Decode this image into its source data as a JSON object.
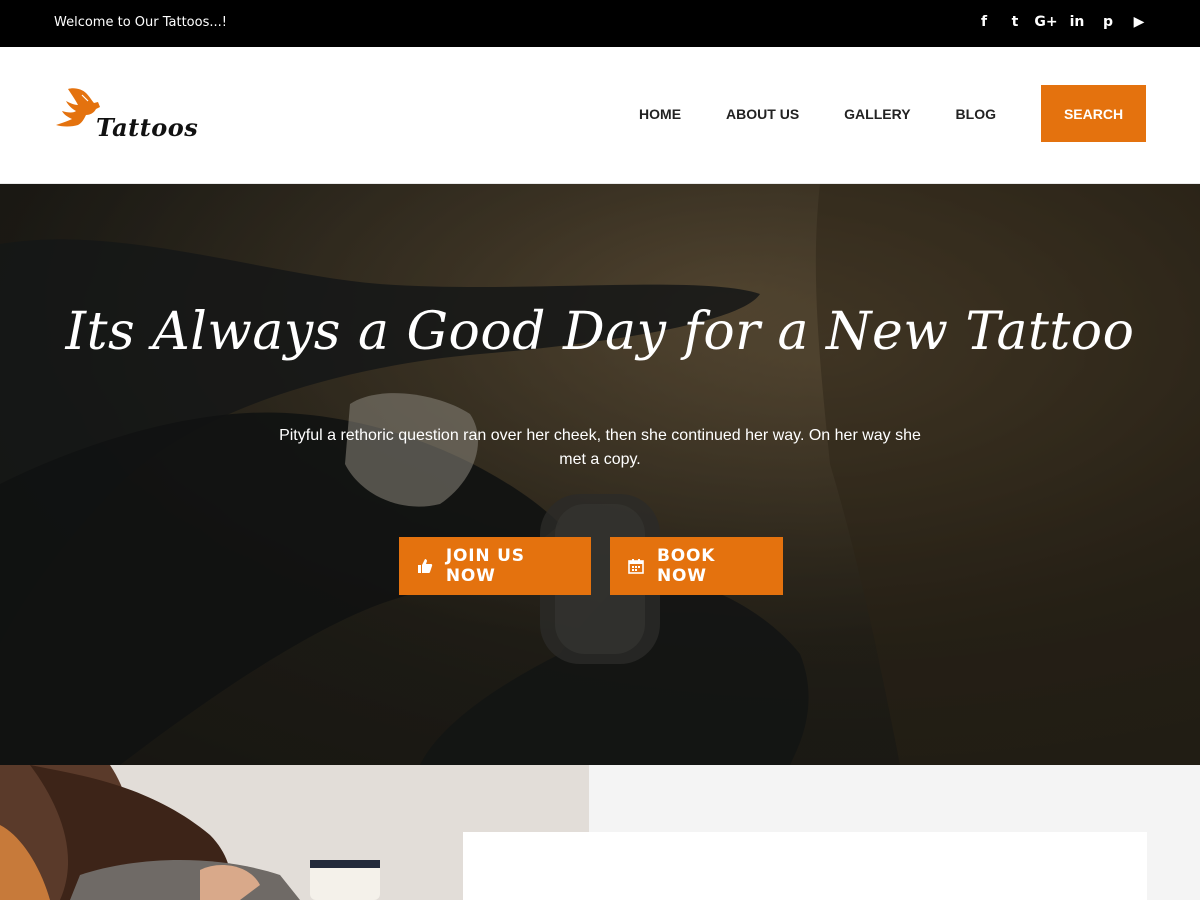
{
  "topbar": {
    "welcome": "Welcome to Our Tattoos...!",
    "social": [
      {
        "icon": "facebook-icon",
        "glyph": "f"
      },
      {
        "icon": "twitter-icon",
        "glyph": "t"
      },
      {
        "icon": "google-plus-icon",
        "glyph": "G+"
      },
      {
        "icon": "linkedin-icon",
        "glyph": "in"
      },
      {
        "icon": "pinterest-icon",
        "glyph": "p"
      },
      {
        "icon": "youtube-icon",
        "glyph": "▶"
      }
    ]
  },
  "header": {
    "logo_text": "Tattoos",
    "nav": [
      {
        "label": "HOME"
      },
      {
        "label": "ABOUT US"
      },
      {
        "label": "GALLERY"
      },
      {
        "label": "BLOG"
      }
    ],
    "search_label": "SEARCH"
  },
  "hero": {
    "title": "Its Always a Good Day for a New Tattoo",
    "subtitle": "Pityful a rethoric question ran over her cheek, then she continued her way. On her way she met a copy.",
    "buttons": {
      "join": "JOIN US NOW",
      "book": "BOOK NOW"
    }
  },
  "colors": {
    "accent": "#e4720e",
    "topbar_bg": "#000000",
    "text_dark": "#222222"
  }
}
